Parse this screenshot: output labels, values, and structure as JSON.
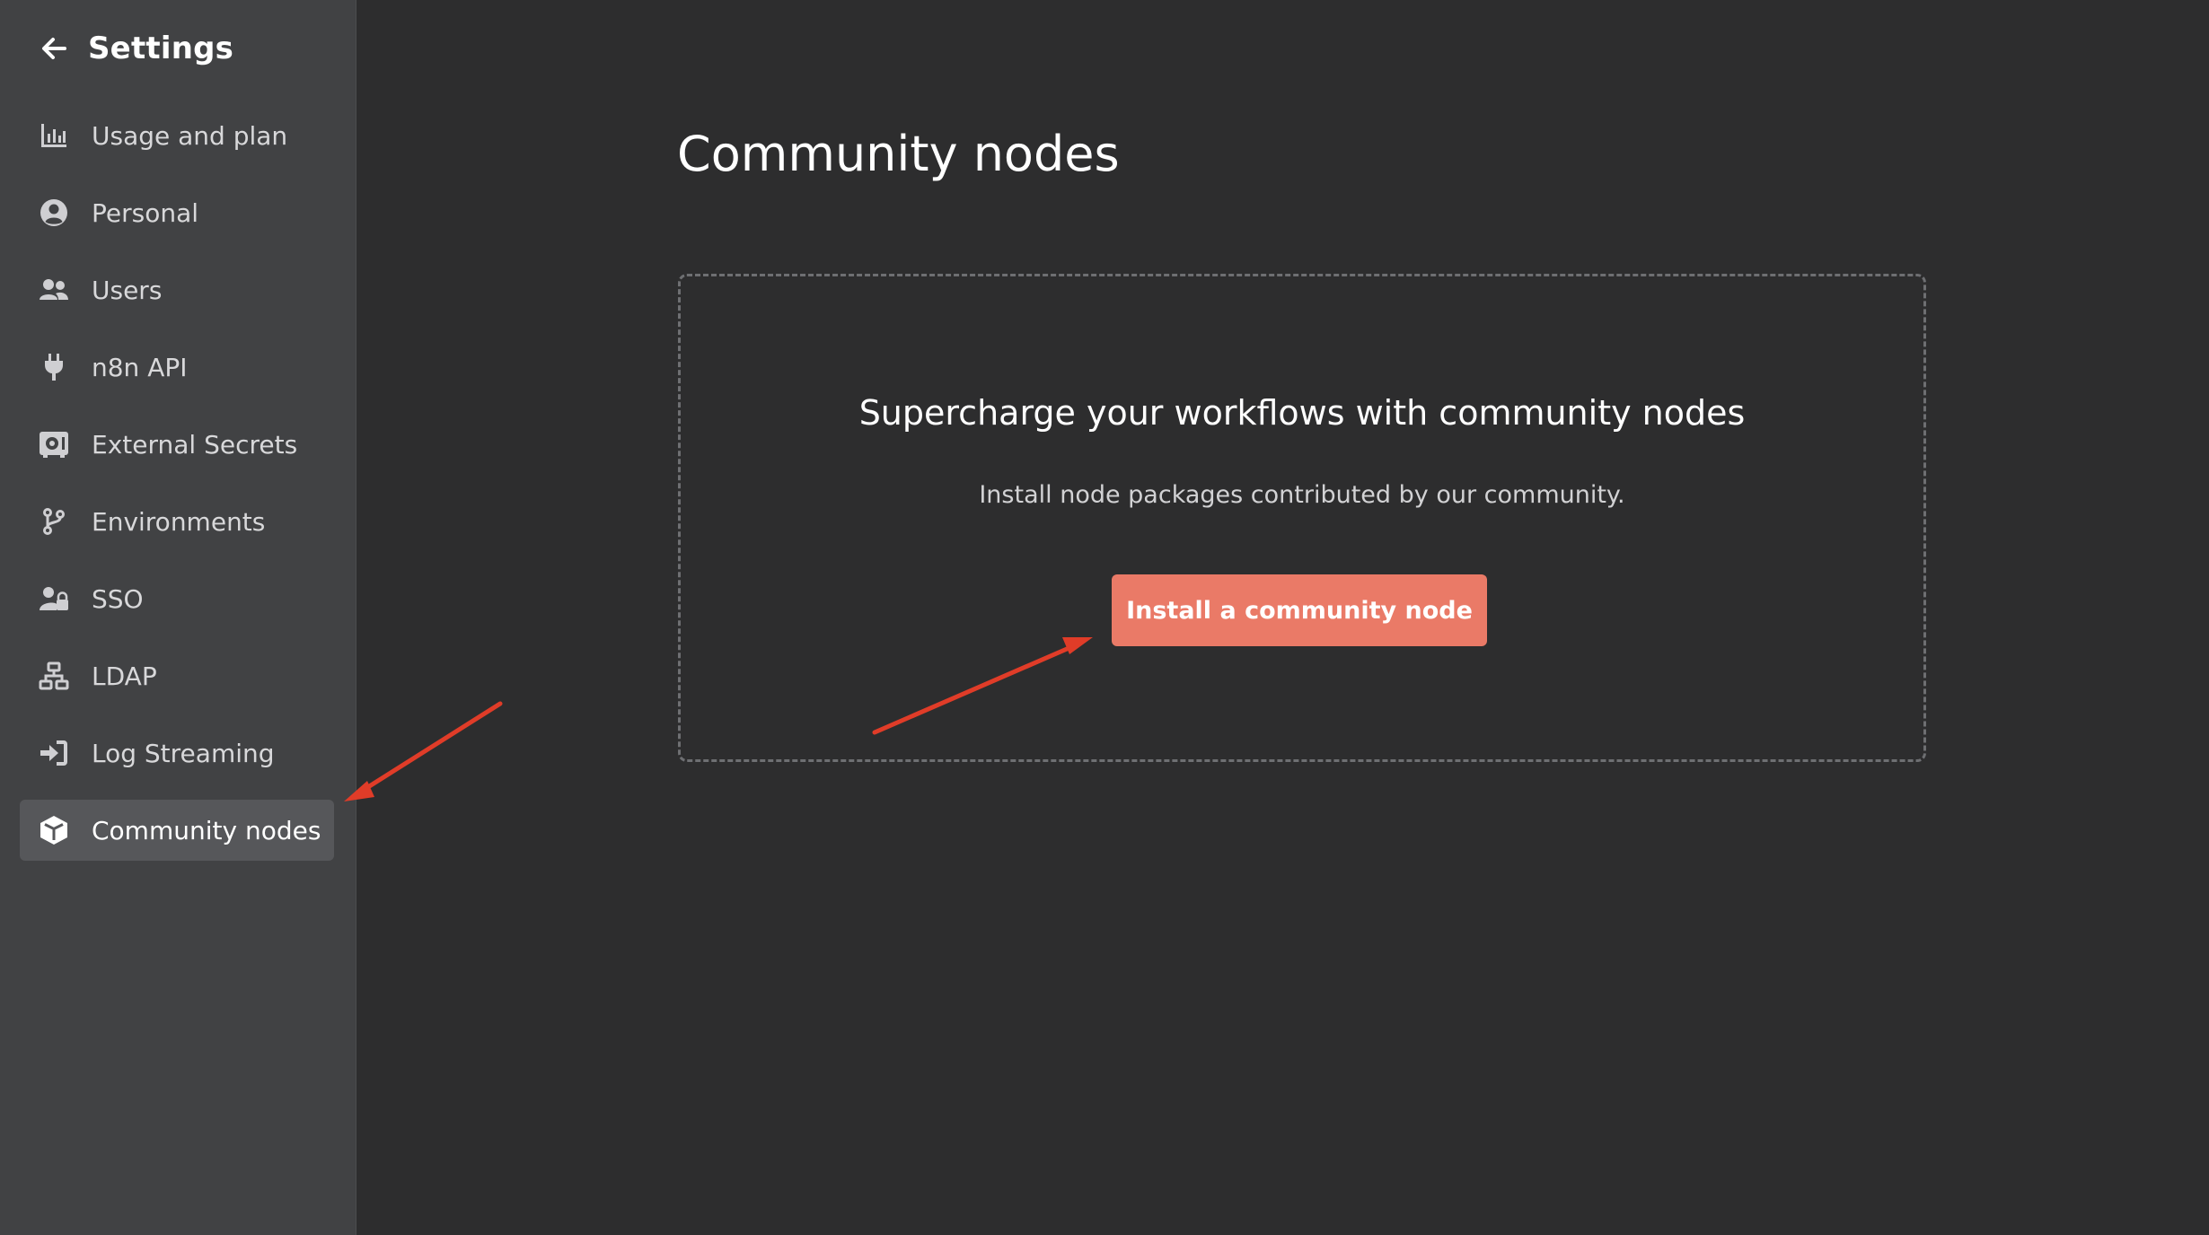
{
  "sidebar": {
    "title": "Settings",
    "back_icon": "arrow-left-icon",
    "items": [
      {
        "label": "Usage and plan",
        "icon": "bar-chart-icon"
      },
      {
        "label": "Personal",
        "icon": "user-circle-icon"
      },
      {
        "label": "Users",
        "icon": "users-icon"
      },
      {
        "label": "n8n API",
        "icon": "plug-icon"
      },
      {
        "label": "External Secrets",
        "icon": "vault-icon"
      },
      {
        "label": "Environments",
        "icon": "git-branch-icon"
      },
      {
        "label": "SSO",
        "icon": "user-lock-icon"
      },
      {
        "label": "LDAP",
        "icon": "network-icon"
      },
      {
        "label": "Log Streaming",
        "icon": "sign-in-icon"
      },
      {
        "label": "Community nodes",
        "icon": "cube-icon",
        "active": true
      }
    ]
  },
  "main": {
    "title": "Community nodes",
    "empty_state": {
      "heading": "Supercharge your workflows with community nodes",
      "description": "Install node packages contributed by our community.",
      "button_label": "Install a community node"
    }
  },
  "colors": {
    "sidebar_bg": "#414244",
    "main_bg": "#2d2d2e",
    "accent": "#ea7a67",
    "annotation_arrow": "#e03c28"
  }
}
